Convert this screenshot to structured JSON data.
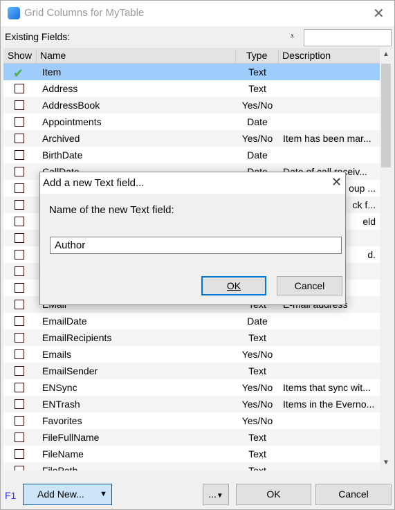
{
  "window": {
    "title": "Grid Columns for MyTable",
    "close_icon": "close-icon",
    "app_icon": "cube-icon"
  },
  "existing_label": "Existing Fields:",
  "filter_icon": "filter-icon",
  "search": {
    "value": ""
  },
  "columns": [
    "Show",
    "Name",
    "Type",
    "Description"
  ],
  "rows": [
    {
      "show": true,
      "name": "Item",
      "type": "Text",
      "desc": "",
      "selected": true
    },
    {
      "show": false,
      "name": "Address",
      "type": "Text",
      "desc": ""
    },
    {
      "show": false,
      "name": "AddressBook",
      "type": "Yes/No",
      "desc": ""
    },
    {
      "show": false,
      "name": "Appointments",
      "type": "Date",
      "desc": ""
    },
    {
      "show": false,
      "name": "Archived",
      "type": "Yes/No",
      "desc": "Item has been mar..."
    },
    {
      "show": false,
      "name": "BirthDate",
      "type": "Date",
      "desc": ""
    },
    {
      "show": false,
      "name": "CallDate",
      "type": "Date",
      "desc": "Date of call receiv..."
    },
    {
      "show": false,
      "name": "",
      "type": "",
      "desc": "oup ...",
      "frag": true
    },
    {
      "show": false,
      "name": "",
      "type": "",
      "desc": "ck f...",
      "frag": true
    },
    {
      "show": false,
      "name": "",
      "type": "",
      "desc": "eld",
      "frag": true
    },
    {
      "show": false,
      "name": "",
      "type": "",
      "desc": ""
    },
    {
      "show": false,
      "name": "",
      "type": "",
      "desc": "d.",
      "frag": true
    },
    {
      "show": false,
      "name": "",
      "type": "",
      "desc": ""
    },
    {
      "show": false,
      "name": "",
      "type": "",
      "desc": ""
    },
    {
      "show": false,
      "name": "EMail",
      "type": "Text",
      "desc": "E-mail address"
    },
    {
      "show": false,
      "name": "EmailDate",
      "type": "Date",
      "desc": ""
    },
    {
      "show": false,
      "name": "EmailRecipients",
      "type": "Text",
      "desc": ""
    },
    {
      "show": false,
      "name": "Emails",
      "type": "Yes/No",
      "desc": ""
    },
    {
      "show": false,
      "name": "EmailSender",
      "type": "Text",
      "desc": ""
    },
    {
      "show": false,
      "name": "ENSync",
      "type": "Yes/No",
      "desc": "Items that sync wit..."
    },
    {
      "show": false,
      "name": "ENTrash",
      "type": "Yes/No",
      "desc": "Items in the Everno..."
    },
    {
      "show": false,
      "name": "Favorites",
      "type": "Yes/No",
      "desc": ""
    },
    {
      "show": false,
      "name": "FileFullName",
      "type": "Text",
      "desc": ""
    },
    {
      "show": false,
      "name": "FileName",
      "type": "Text",
      "desc": ""
    },
    {
      "show": false,
      "name": "FilePath",
      "type": "Text",
      "desc": ""
    }
  ],
  "colors": {
    "selected_row": "#9fcdfb",
    "alt_row": "#f5f5f5",
    "accent": "#0078d7"
  },
  "footer": {
    "help": "F1",
    "add_new": "Add New...",
    "more": "...",
    "ok": "OK",
    "cancel": "Cancel"
  },
  "dialog": {
    "title": "Add a new Text field...",
    "label": "Name of the new Text field:",
    "value": "Author",
    "ok": "OK",
    "cancel": "Cancel"
  }
}
